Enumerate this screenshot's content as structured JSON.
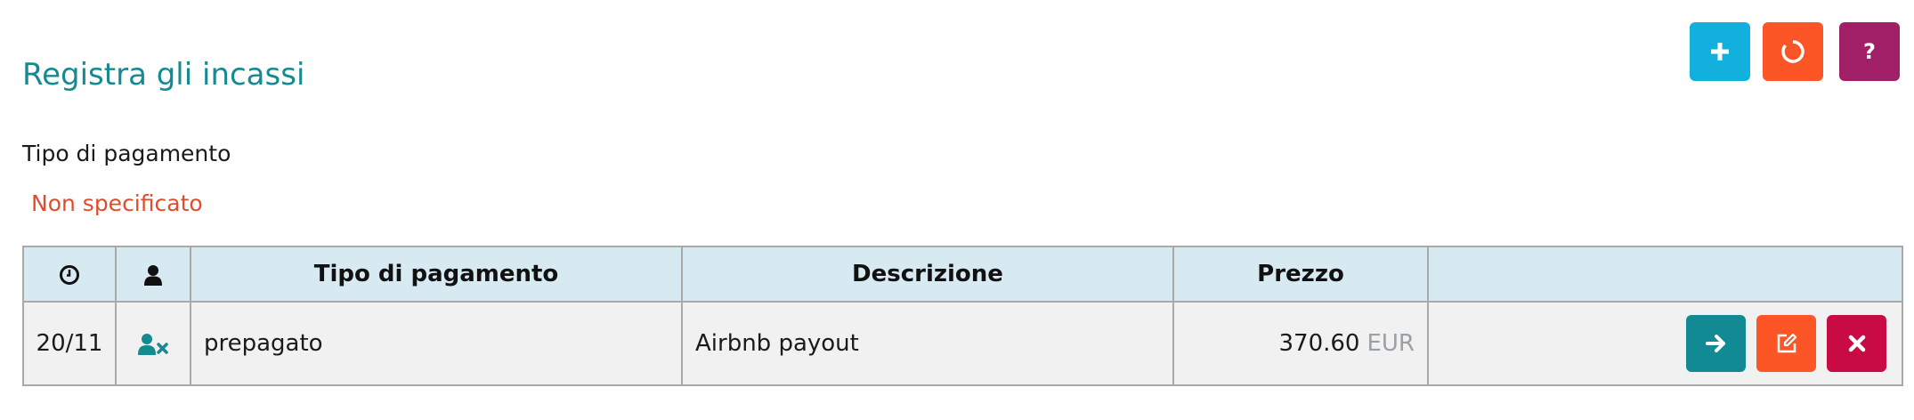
{
  "toolbar": {
    "add_icon": "plus-icon",
    "refresh_icon": "refresh-icon",
    "help_label": "?",
    "colors": {
      "add": "#12b0dc",
      "refresh": "#fc5627",
      "help": "#a01f67"
    }
  },
  "page": {
    "title": "Registra gli incassi",
    "payment_type_label": "Tipo di pagamento",
    "payment_type_value": "Non specificato"
  },
  "table": {
    "headers": {
      "time_icon": "clock-icon",
      "user_icon": "user-icon",
      "type": "Tipo di pagamento",
      "description": "Descrizione",
      "price": "Prezzo",
      "actions": ""
    },
    "rows": [
      {
        "date": "20/11",
        "user_icon": "user-remove-icon",
        "type": "prepagato",
        "description": "Airbnb payout",
        "price": "370.60",
        "currency": "EUR",
        "actions": [
          "arrow-right-icon",
          "edit-icon",
          "delete-icon"
        ]
      }
    ]
  },
  "colors": {
    "accent": "#158a90",
    "warning": "#e34c2a",
    "header_bg": "#d7e9f1",
    "row_bg": "#f1f1f1",
    "go": "#128a93",
    "edit": "#fc5627",
    "delete": "#c80b45"
  }
}
